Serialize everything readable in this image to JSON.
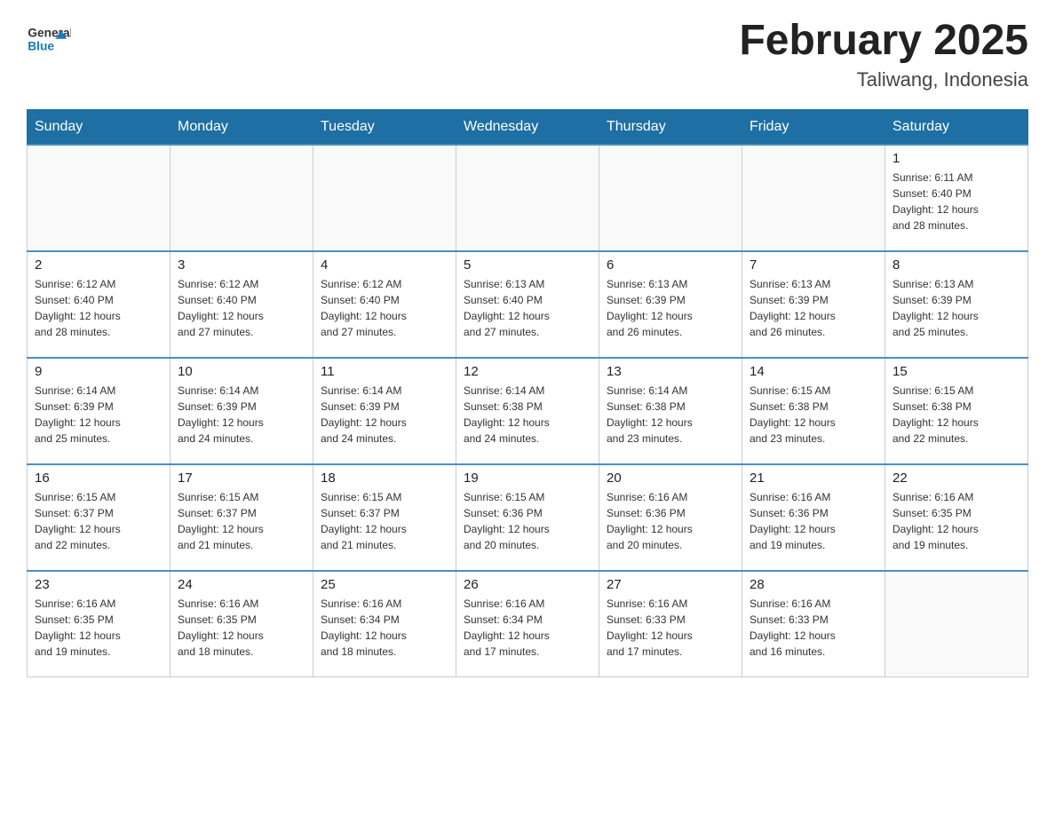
{
  "header": {
    "logo_general": "General",
    "logo_blue": "Blue",
    "month_title": "February 2025",
    "location": "Taliwang, Indonesia"
  },
  "weekdays": [
    "Sunday",
    "Monday",
    "Tuesday",
    "Wednesday",
    "Thursday",
    "Friday",
    "Saturday"
  ],
  "weeks": [
    [
      {
        "day": "",
        "info": ""
      },
      {
        "day": "",
        "info": ""
      },
      {
        "day": "",
        "info": ""
      },
      {
        "day": "",
        "info": ""
      },
      {
        "day": "",
        "info": ""
      },
      {
        "day": "",
        "info": ""
      },
      {
        "day": "1",
        "info": "Sunrise: 6:11 AM\nSunset: 6:40 PM\nDaylight: 12 hours\nand 28 minutes."
      }
    ],
    [
      {
        "day": "2",
        "info": "Sunrise: 6:12 AM\nSunset: 6:40 PM\nDaylight: 12 hours\nand 28 minutes."
      },
      {
        "day": "3",
        "info": "Sunrise: 6:12 AM\nSunset: 6:40 PM\nDaylight: 12 hours\nand 27 minutes."
      },
      {
        "day": "4",
        "info": "Sunrise: 6:12 AM\nSunset: 6:40 PM\nDaylight: 12 hours\nand 27 minutes."
      },
      {
        "day": "5",
        "info": "Sunrise: 6:13 AM\nSunset: 6:40 PM\nDaylight: 12 hours\nand 27 minutes."
      },
      {
        "day": "6",
        "info": "Sunrise: 6:13 AM\nSunset: 6:39 PM\nDaylight: 12 hours\nand 26 minutes."
      },
      {
        "day": "7",
        "info": "Sunrise: 6:13 AM\nSunset: 6:39 PM\nDaylight: 12 hours\nand 26 minutes."
      },
      {
        "day": "8",
        "info": "Sunrise: 6:13 AM\nSunset: 6:39 PM\nDaylight: 12 hours\nand 25 minutes."
      }
    ],
    [
      {
        "day": "9",
        "info": "Sunrise: 6:14 AM\nSunset: 6:39 PM\nDaylight: 12 hours\nand 25 minutes."
      },
      {
        "day": "10",
        "info": "Sunrise: 6:14 AM\nSunset: 6:39 PM\nDaylight: 12 hours\nand 24 minutes."
      },
      {
        "day": "11",
        "info": "Sunrise: 6:14 AM\nSunset: 6:39 PM\nDaylight: 12 hours\nand 24 minutes."
      },
      {
        "day": "12",
        "info": "Sunrise: 6:14 AM\nSunset: 6:38 PM\nDaylight: 12 hours\nand 24 minutes."
      },
      {
        "day": "13",
        "info": "Sunrise: 6:14 AM\nSunset: 6:38 PM\nDaylight: 12 hours\nand 23 minutes."
      },
      {
        "day": "14",
        "info": "Sunrise: 6:15 AM\nSunset: 6:38 PM\nDaylight: 12 hours\nand 23 minutes."
      },
      {
        "day": "15",
        "info": "Sunrise: 6:15 AM\nSunset: 6:38 PM\nDaylight: 12 hours\nand 22 minutes."
      }
    ],
    [
      {
        "day": "16",
        "info": "Sunrise: 6:15 AM\nSunset: 6:37 PM\nDaylight: 12 hours\nand 22 minutes."
      },
      {
        "day": "17",
        "info": "Sunrise: 6:15 AM\nSunset: 6:37 PM\nDaylight: 12 hours\nand 21 minutes."
      },
      {
        "day": "18",
        "info": "Sunrise: 6:15 AM\nSunset: 6:37 PM\nDaylight: 12 hours\nand 21 minutes."
      },
      {
        "day": "19",
        "info": "Sunrise: 6:15 AM\nSunset: 6:36 PM\nDaylight: 12 hours\nand 20 minutes."
      },
      {
        "day": "20",
        "info": "Sunrise: 6:16 AM\nSunset: 6:36 PM\nDaylight: 12 hours\nand 20 minutes."
      },
      {
        "day": "21",
        "info": "Sunrise: 6:16 AM\nSunset: 6:36 PM\nDaylight: 12 hours\nand 19 minutes."
      },
      {
        "day": "22",
        "info": "Sunrise: 6:16 AM\nSunset: 6:35 PM\nDaylight: 12 hours\nand 19 minutes."
      }
    ],
    [
      {
        "day": "23",
        "info": "Sunrise: 6:16 AM\nSunset: 6:35 PM\nDaylight: 12 hours\nand 19 minutes."
      },
      {
        "day": "24",
        "info": "Sunrise: 6:16 AM\nSunset: 6:35 PM\nDaylight: 12 hours\nand 18 minutes."
      },
      {
        "day": "25",
        "info": "Sunrise: 6:16 AM\nSunset: 6:34 PM\nDaylight: 12 hours\nand 18 minutes."
      },
      {
        "day": "26",
        "info": "Sunrise: 6:16 AM\nSunset: 6:34 PM\nDaylight: 12 hours\nand 17 minutes."
      },
      {
        "day": "27",
        "info": "Sunrise: 6:16 AM\nSunset: 6:33 PM\nDaylight: 12 hours\nand 17 minutes."
      },
      {
        "day": "28",
        "info": "Sunrise: 6:16 AM\nSunset: 6:33 PM\nDaylight: 12 hours\nand 16 minutes."
      },
      {
        "day": "",
        "info": ""
      }
    ]
  ]
}
